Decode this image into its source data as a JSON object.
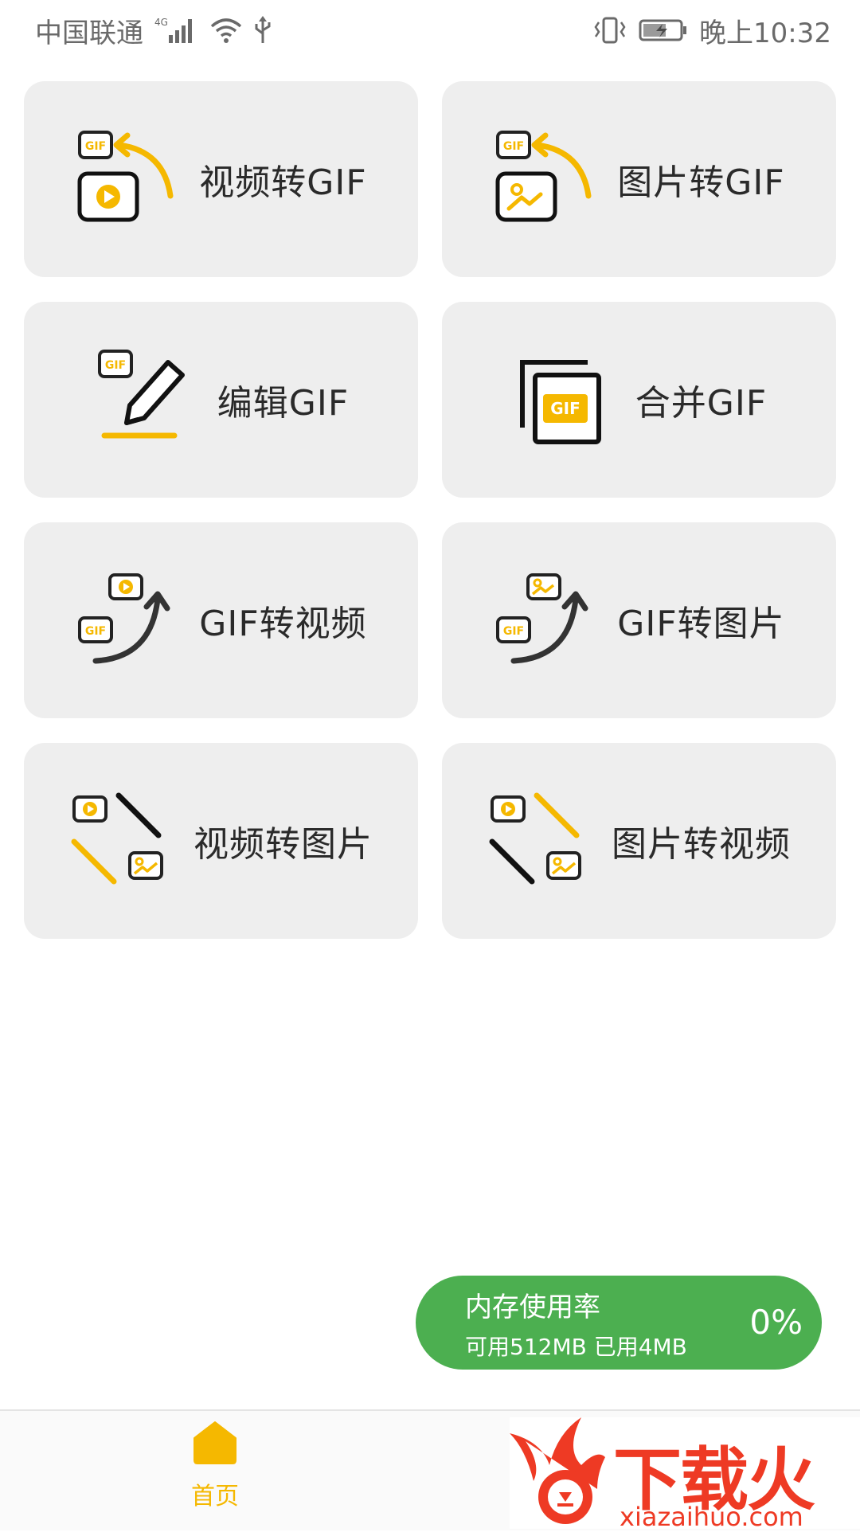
{
  "status_bar": {
    "carrier": "中国联通",
    "network": "4G",
    "time": "晚上10:32"
  },
  "tiles": [
    {
      "label": "视频转GIF",
      "icon": "video-to-gif-icon"
    },
    {
      "label": "图片转GIF",
      "icon": "image-to-gif-icon"
    },
    {
      "label": "编辑GIF",
      "icon": "edit-gif-icon"
    },
    {
      "label": "合并GIF",
      "icon": "merge-gif-icon"
    },
    {
      "label": "GIF转视频",
      "icon": "gif-to-video-icon"
    },
    {
      "label": "GIF转图片",
      "icon": "gif-to-image-icon"
    },
    {
      "label": "视频转图片",
      "icon": "video-to-image-icon"
    },
    {
      "label": "图片转视频",
      "icon": "image-to-video-icon"
    }
  ],
  "memory": {
    "title": "内存使用率",
    "subtitle": "可用512MB 已用4MB",
    "percent": "0%"
  },
  "bottom_nav": {
    "home_label": "首页"
  },
  "watermark": {
    "brand": "下载火",
    "url": "xiazaihuo.com"
  },
  "colors": {
    "accent": "#f5b800",
    "tile_bg": "#eeeeee",
    "memory_bg": "#4caf50",
    "watermark": "#ee3a24"
  }
}
